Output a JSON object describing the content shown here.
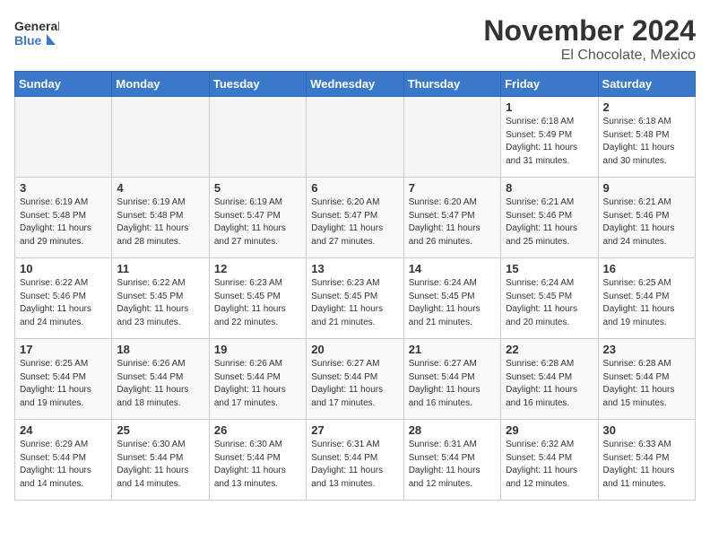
{
  "logo": {
    "text_general": "General",
    "text_blue": "Blue"
  },
  "header": {
    "month": "November 2024",
    "location": "El Chocolate, Mexico"
  },
  "weekdays": [
    "Sunday",
    "Monday",
    "Tuesday",
    "Wednesday",
    "Thursday",
    "Friday",
    "Saturday"
  ],
  "weeks": [
    [
      {
        "day": "",
        "empty": true
      },
      {
        "day": "",
        "empty": true
      },
      {
        "day": "",
        "empty": true
      },
      {
        "day": "",
        "empty": true
      },
      {
        "day": "",
        "empty": true
      },
      {
        "day": "1",
        "sunrise": "6:18 AM",
        "sunset": "5:49 PM",
        "daylight": "11 hours and 31 minutes."
      },
      {
        "day": "2",
        "sunrise": "6:18 AM",
        "sunset": "5:48 PM",
        "daylight": "11 hours and 30 minutes."
      }
    ],
    [
      {
        "day": "3",
        "sunrise": "6:19 AM",
        "sunset": "5:48 PM",
        "daylight": "11 hours and 29 minutes."
      },
      {
        "day": "4",
        "sunrise": "6:19 AM",
        "sunset": "5:48 PM",
        "daylight": "11 hours and 28 minutes."
      },
      {
        "day": "5",
        "sunrise": "6:19 AM",
        "sunset": "5:47 PM",
        "daylight": "11 hours and 27 minutes."
      },
      {
        "day": "6",
        "sunrise": "6:20 AM",
        "sunset": "5:47 PM",
        "daylight": "11 hours and 27 minutes."
      },
      {
        "day": "7",
        "sunrise": "6:20 AM",
        "sunset": "5:47 PM",
        "daylight": "11 hours and 26 minutes."
      },
      {
        "day": "8",
        "sunrise": "6:21 AM",
        "sunset": "5:46 PM",
        "daylight": "11 hours and 25 minutes."
      },
      {
        "day": "9",
        "sunrise": "6:21 AM",
        "sunset": "5:46 PM",
        "daylight": "11 hours and 24 minutes."
      }
    ],
    [
      {
        "day": "10",
        "sunrise": "6:22 AM",
        "sunset": "5:46 PM",
        "daylight": "11 hours and 24 minutes."
      },
      {
        "day": "11",
        "sunrise": "6:22 AM",
        "sunset": "5:45 PM",
        "daylight": "11 hours and 23 minutes."
      },
      {
        "day": "12",
        "sunrise": "6:23 AM",
        "sunset": "5:45 PM",
        "daylight": "11 hours and 22 minutes."
      },
      {
        "day": "13",
        "sunrise": "6:23 AM",
        "sunset": "5:45 PM",
        "daylight": "11 hours and 21 minutes."
      },
      {
        "day": "14",
        "sunrise": "6:24 AM",
        "sunset": "5:45 PM",
        "daylight": "11 hours and 21 minutes."
      },
      {
        "day": "15",
        "sunrise": "6:24 AM",
        "sunset": "5:45 PM",
        "daylight": "11 hours and 20 minutes."
      },
      {
        "day": "16",
        "sunrise": "6:25 AM",
        "sunset": "5:44 PM",
        "daylight": "11 hours and 19 minutes."
      }
    ],
    [
      {
        "day": "17",
        "sunrise": "6:25 AM",
        "sunset": "5:44 PM",
        "daylight": "11 hours and 19 minutes."
      },
      {
        "day": "18",
        "sunrise": "6:26 AM",
        "sunset": "5:44 PM",
        "daylight": "11 hours and 18 minutes."
      },
      {
        "day": "19",
        "sunrise": "6:26 AM",
        "sunset": "5:44 PM",
        "daylight": "11 hours and 17 minutes."
      },
      {
        "day": "20",
        "sunrise": "6:27 AM",
        "sunset": "5:44 PM",
        "daylight": "11 hours and 17 minutes."
      },
      {
        "day": "21",
        "sunrise": "6:27 AM",
        "sunset": "5:44 PM",
        "daylight": "11 hours and 16 minutes."
      },
      {
        "day": "22",
        "sunrise": "6:28 AM",
        "sunset": "5:44 PM",
        "daylight": "11 hours and 16 minutes."
      },
      {
        "day": "23",
        "sunrise": "6:28 AM",
        "sunset": "5:44 PM",
        "daylight": "11 hours and 15 minutes."
      }
    ],
    [
      {
        "day": "24",
        "sunrise": "6:29 AM",
        "sunset": "5:44 PM",
        "daylight": "11 hours and 14 minutes."
      },
      {
        "day": "25",
        "sunrise": "6:30 AM",
        "sunset": "5:44 PM",
        "daylight": "11 hours and 14 minutes."
      },
      {
        "day": "26",
        "sunrise": "6:30 AM",
        "sunset": "5:44 PM",
        "daylight": "11 hours and 13 minutes."
      },
      {
        "day": "27",
        "sunrise": "6:31 AM",
        "sunset": "5:44 PM",
        "daylight": "11 hours and 13 minutes."
      },
      {
        "day": "28",
        "sunrise": "6:31 AM",
        "sunset": "5:44 PM",
        "daylight": "11 hours and 12 minutes."
      },
      {
        "day": "29",
        "sunrise": "6:32 AM",
        "sunset": "5:44 PM",
        "daylight": "11 hours and 12 minutes."
      },
      {
        "day": "30",
        "sunrise": "6:33 AM",
        "sunset": "5:44 PM",
        "daylight": "11 hours and 11 minutes."
      }
    ]
  ]
}
